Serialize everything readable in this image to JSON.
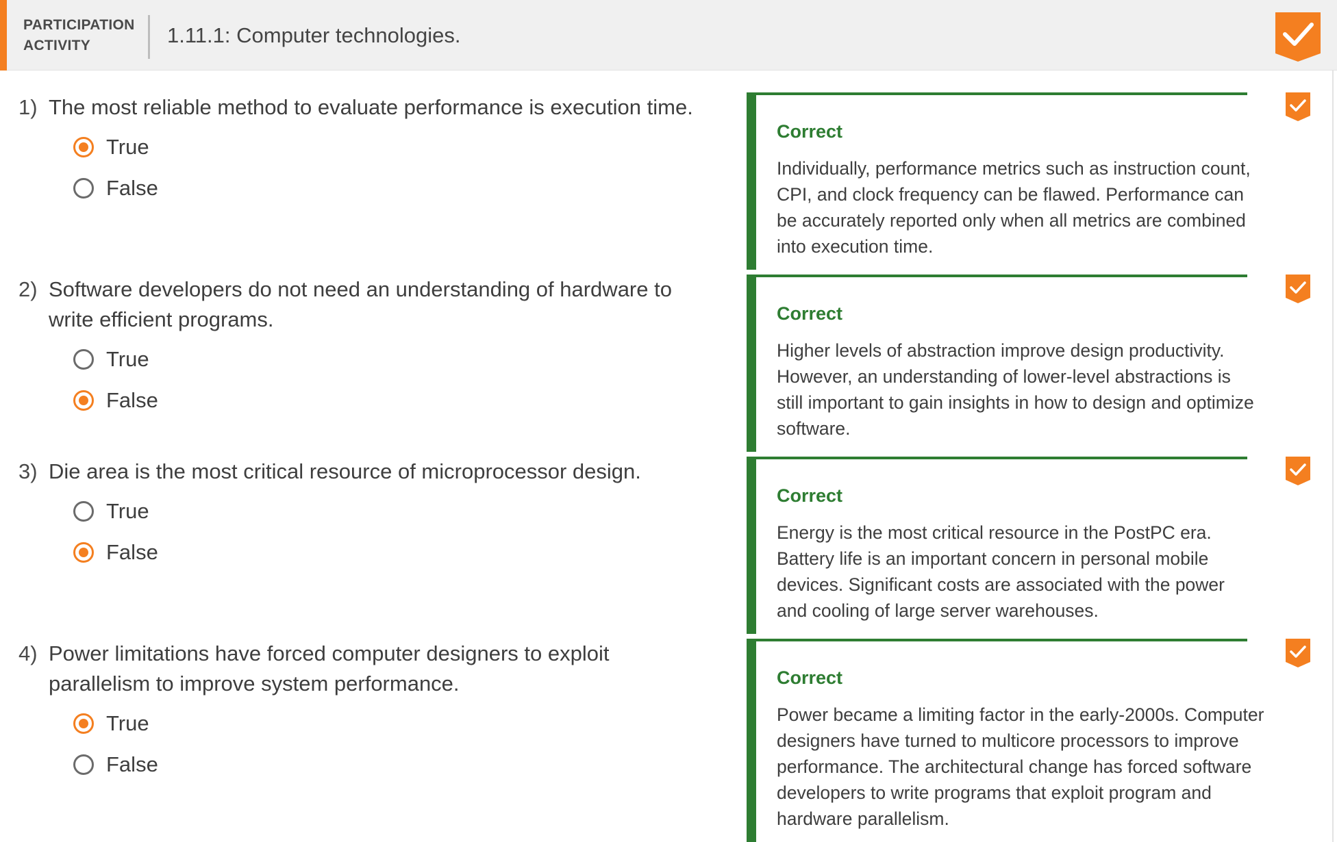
{
  "header": {
    "activity_type": "PARTICIPATION ACTIVITY",
    "title": "1.11.1: Computer technologies.",
    "accent_color": "#f47f20",
    "completion_icon": "check-badge-icon"
  },
  "questions": [
    {
      "number": "1)",
      "text": "The most reliable method to evaluate performance is execution time.",
      "options": [
        {
          "label": "True",
          "selected": true
        },
        {
          "label": "False",
          "selected": false
        }
      ],
      "feedback_status": "Correct",
      "feedback_text": "Individually, performance metrics such as instruction count, CPI, and clock frequency can be flawed. Performance can be accurately reported only when all metrics are combined into execution time."
    },
    {
      "number": "2)",
      "text": "Software developers do not need an understanding of hardware to write efficient programs.",
      "options": [
        {
          "label": "True",
          "selected": false
        },
        {
          "label": "False",
          "selected": true
        }
      ],
      "feedback_status": "Correct",
      "feedback_text": "Higher levels of abstraction improve design productivity. However, an understanding of lower-level abstractions is still important to gain insights in how to design and optimize software."
    },
    {
      "number": "3)",
      "text": "Die area is the most critical resource of microprocessor design.",
      "options": [
        {
          "label": "True",
          "selected": false
        },
        {
          "label": "False",
          "selected": true
        }
      ],
      "feedback_status": "Correct",
      "feedback_text": "Energy is the most critical resource in the PostPC era. Battery life is an important concern in personal mobile devices. Significant costs are associated with the power and cooling of large server warehouses."
    },
    {
      "number": "4)",
      "text": "Power limitations have forced computer designers to exploit parallelism to improve system performance.",
      "options": [
        {
          "label": "True",
          "selected": true
        },
        {
          "label": "False",
          "selected": false
        }
      ],
      "feedback_status": "Correct",
      "feedback_text": "Power became a limiting factor in the early-2000s. Computer designers have turned to multicore processors to improve performance. The architectural change has forced software developers to write programs that exploit program and hardware parallelism."
    }
  ],
  "colors": {
    "correct": "#2e7d32",
    "accent": "#f47f20"
  }
}
